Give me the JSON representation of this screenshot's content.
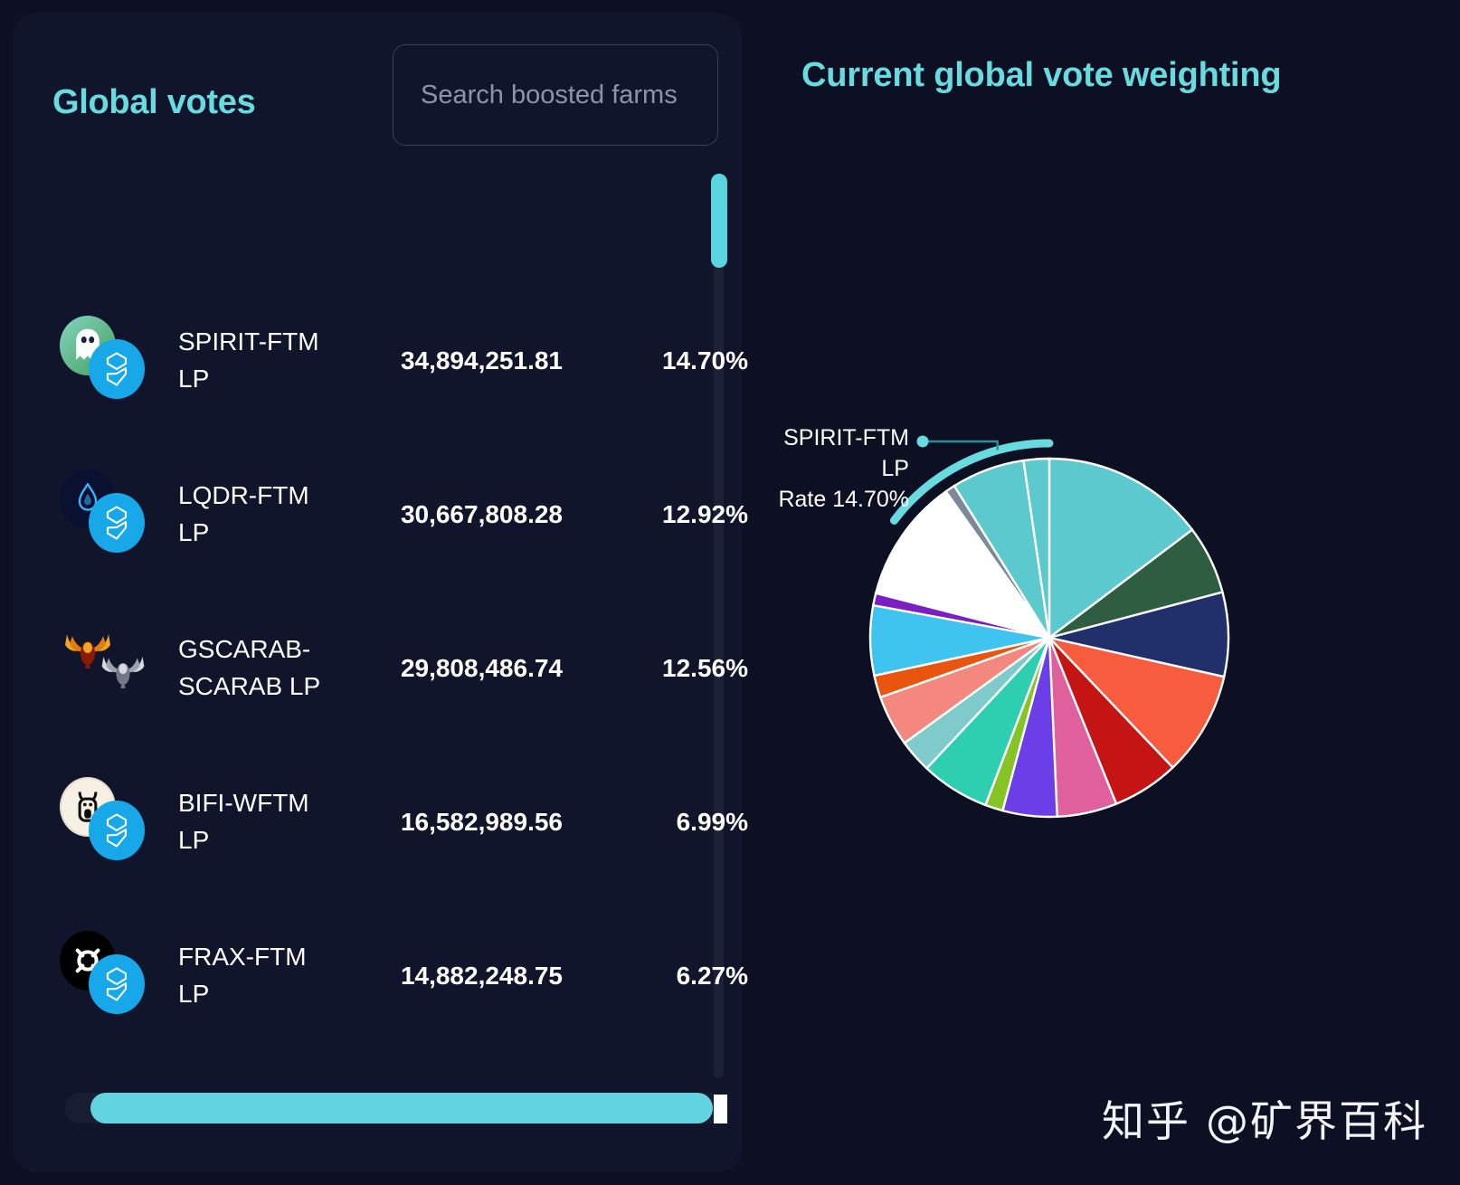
{
  "panel": {
    "title": "Global votes",
    "search_placeholder": "Search boosted farms",
    "search_value": ""
  },
  "rows": [
    {
      "name": "SPIRIT-FTM LP",
      "votes": "34,894,251.81",
      "rate": "14.70%",
      "icon": "spirit-ghost-icon",
      "icon2": "fantom-icon"
    },
    {
      "name": "LQDR-FTM LP",
      "votes": "30,667,808.28",
      "rate": "12.92%",
      "icon": "liquiddriver-flame-icon",
      "icon2": "fantom-icon"
    },
    {
      "name": "GSCARAB-SCARAB LP",
      "votes": "29,808,486.74",
      "rate": "12.56%",
      "icon": "gscarab-icon",
      "icon2": "scarab-icon"
    },
    {
      "name": "BIFI-WFTM LP",
      "votes": "16,582,989.56",
      "rate": "6.99%",
      "icon": "beefy-cow-icon",
      "icon2": "fantom-icon"
    },
    {
      "name": "FRAX-FTM LP",
      "votes": "14,882,248.75",
      "rate": "6.27%",
      "icon": "frax-icon",
      "icon2": "fantom-icon"
    }
  ],
  "chart": {
    "title": "Current global vote weighting",
    "annotation_name": "SPIRIT-FTM LP",
    "annotation_rate": "Rate 14.70%"
  },
  "watermark": "知乎 @矿界百科",
  "colors": {
    "accent": "#68dbe0",
    "page_bg": "#0c1022",
    "card_bg": "#10152c",
    "scroll_thumb": "#62d3e0",
    "text": "#ffffff"
  },
  "chart_data": {
    "type": "pie",
    "title": "Current global vote weighting",
    "legend": "none",
    "highlight": {
      "label": "SPIRIT-FTM LP",
      "rate": "14.70%"
    },
    "labels": [
      "SPIRIT-FTM LP",
      "slice-2",
      "slice-3",
      "slice-4",
      "slice-5",
      "slice-6",
      "slice-7",
      "slice-8",
      "slice-9",
      "slice-10",
      "slice-11",
      "slice-12",
      "slice-13",
      "slice-14",
      "slice-15",
      "slice-16",
      "slice-17",
      "slice-18"
    ],
    "values": [
      14.7,
      6.2,
      7.6,
      9.4,
      6.0,
      5.4,
      4.9,
      1.6,
      6.2,
      3.0,
      4.6,
      2.0,
      6.3,
      1.1,
      11.2,
      0.9,
      6.6,
      2.3
    ],
    "colors": [
      "#5bc9cd",
      "#2f5d42",
      "#21306b",
      "#f85c3f",
      "#c41514",
      "#e0609d",
      "#6b3ee8",
      "#86c426",
      "#2ecfb0",
      "#7fcbcb",
      "#f4887f",
      "#e9550f",
      "#3fc3ef",
      "#7b1fc4",
      "#ffffff",
      "#7c8998",
      "#5bc9cd",
      "#5bc9cd"
    ],
    "stroke": "#ffffff",
    "units": "percent"
  }
}
